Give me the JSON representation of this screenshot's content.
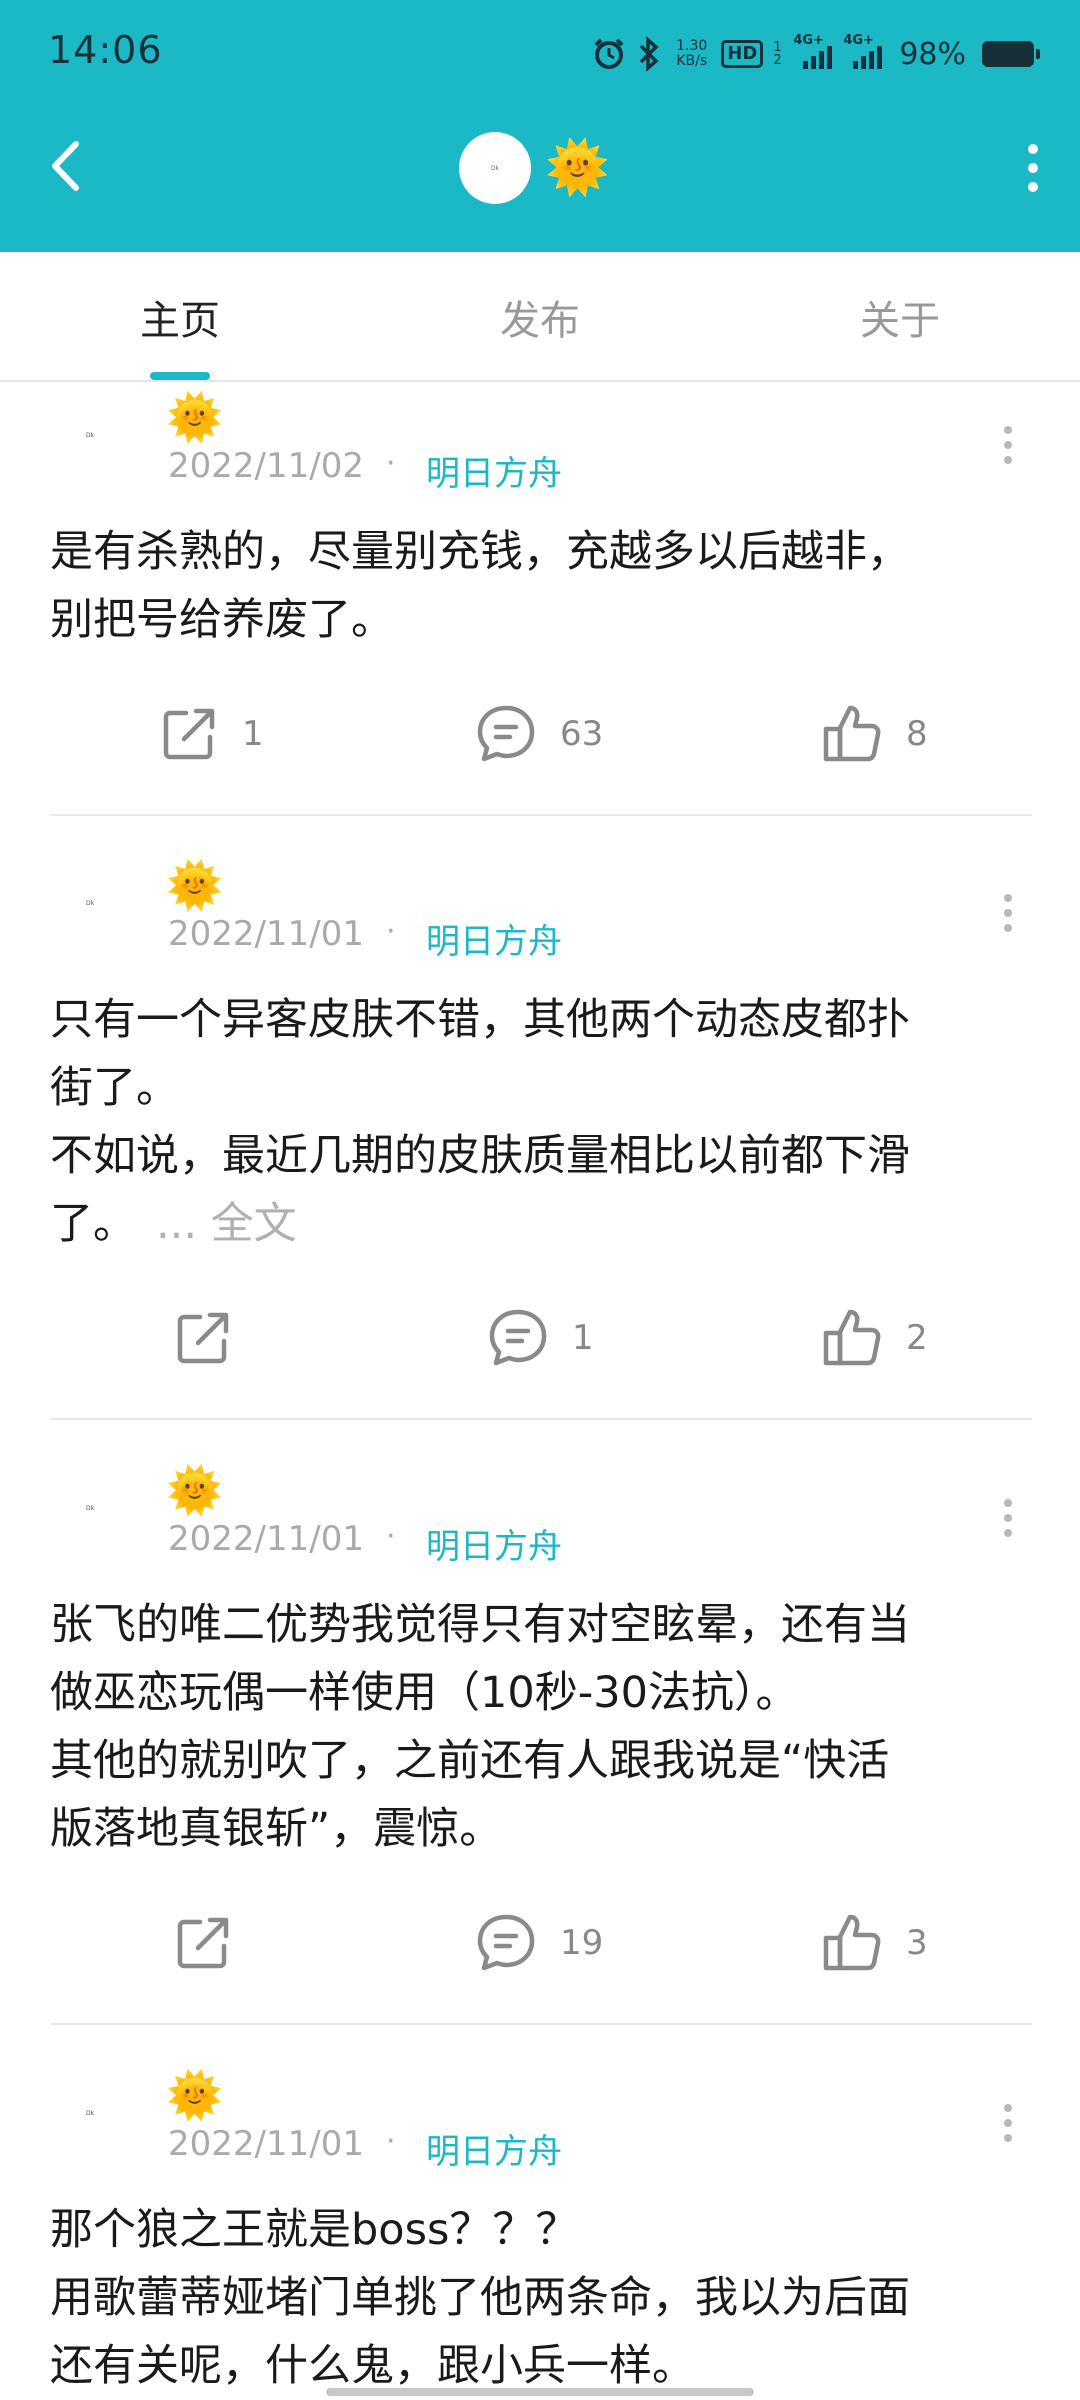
{
  "status_bar": {
    "time": "14:06",
    "net_speed_value": "1.30",
    "net_speed_unit": "KB/s",
    "hd_label": "HD",
    "hd_sub": "1 2",
    "signal_label_1": "4G+",
    "signal_label_2": "4G+",
    "battery_percent": "98%"
  },
  "header": {
    "avatar_text": "Dk",
    "title_emoji": "🌞"
  },
  "tabs": [
    {
      "label": "主页"
    },
    {
      "label": "发布"
    },
    {
      "label": "关于"
    }
  ],
  "posts": [
    {
      "avatar_text": "Dk",
      "emoji": "🌞",
      "date": "2022/11/02",
      "separator": "·",
      "tag": "明日方舟",
      "lines": [
        "是有杀熟的，尽量别充钱，充越多以后越非，",
        "别把号给养废了。"
      ],
      "more_text": "",
      "share_count": "1",
      "comment_count": "63",
      "like_count": "8"
    },
    {
      "avatar_text": "Dk",
      "emoji": "🌞",
      "date": "2022/11/01",
      "separator": "·",
      "tag": "明日方舟",
      "lines": [
        "只有一个异客皮肤不错，其他两个动态皮都扑",
        "街了。",
        "不如说，最近几期的皮肤质量相比以前都下滑",
        "了。"
      ],
      "more_text": "... 全文",
      "share_count": "",
      "comment_count": "1",
      "like_count": "2"
    },
    {
      "avatar_text": "Dk",
      "emoji": "🌞",
      "date": "2022/11/01",
      "separator": "·",
      "tag": "明日方舟",
      "lines": [
        "张飞的唯二优势我觉得只有对空眩晕，还有当",
        "做巫恋玩偶一样使用（10秒-30法抗）。",
        "其他的就别吹了，之前还有人跟我说是“快活",
        "版落地真银斩”，震惊。"
      ],
      "more_text": "",
      "share_count": "",
      "comment_count": "19",
      "like_count": "3"
    },
    {
      "avatar_text": "Dk",
      "emoji": "🌞",
      "date": "2022/11/01",
      "separator": "·",
      "tag": "明日方舟",
      "lines": [
        "那个狼之王就是boss？？？",
        "用歌蕾蒂娅堵门单挑了他两条命，我以为后面",
        "还有关呢，什么鬼，跟小兵一样。"
      ],
      "more_text": "",
      "share_count": "",
      "comment_count": "",
      "like_count": ""
    }
  ]
}
